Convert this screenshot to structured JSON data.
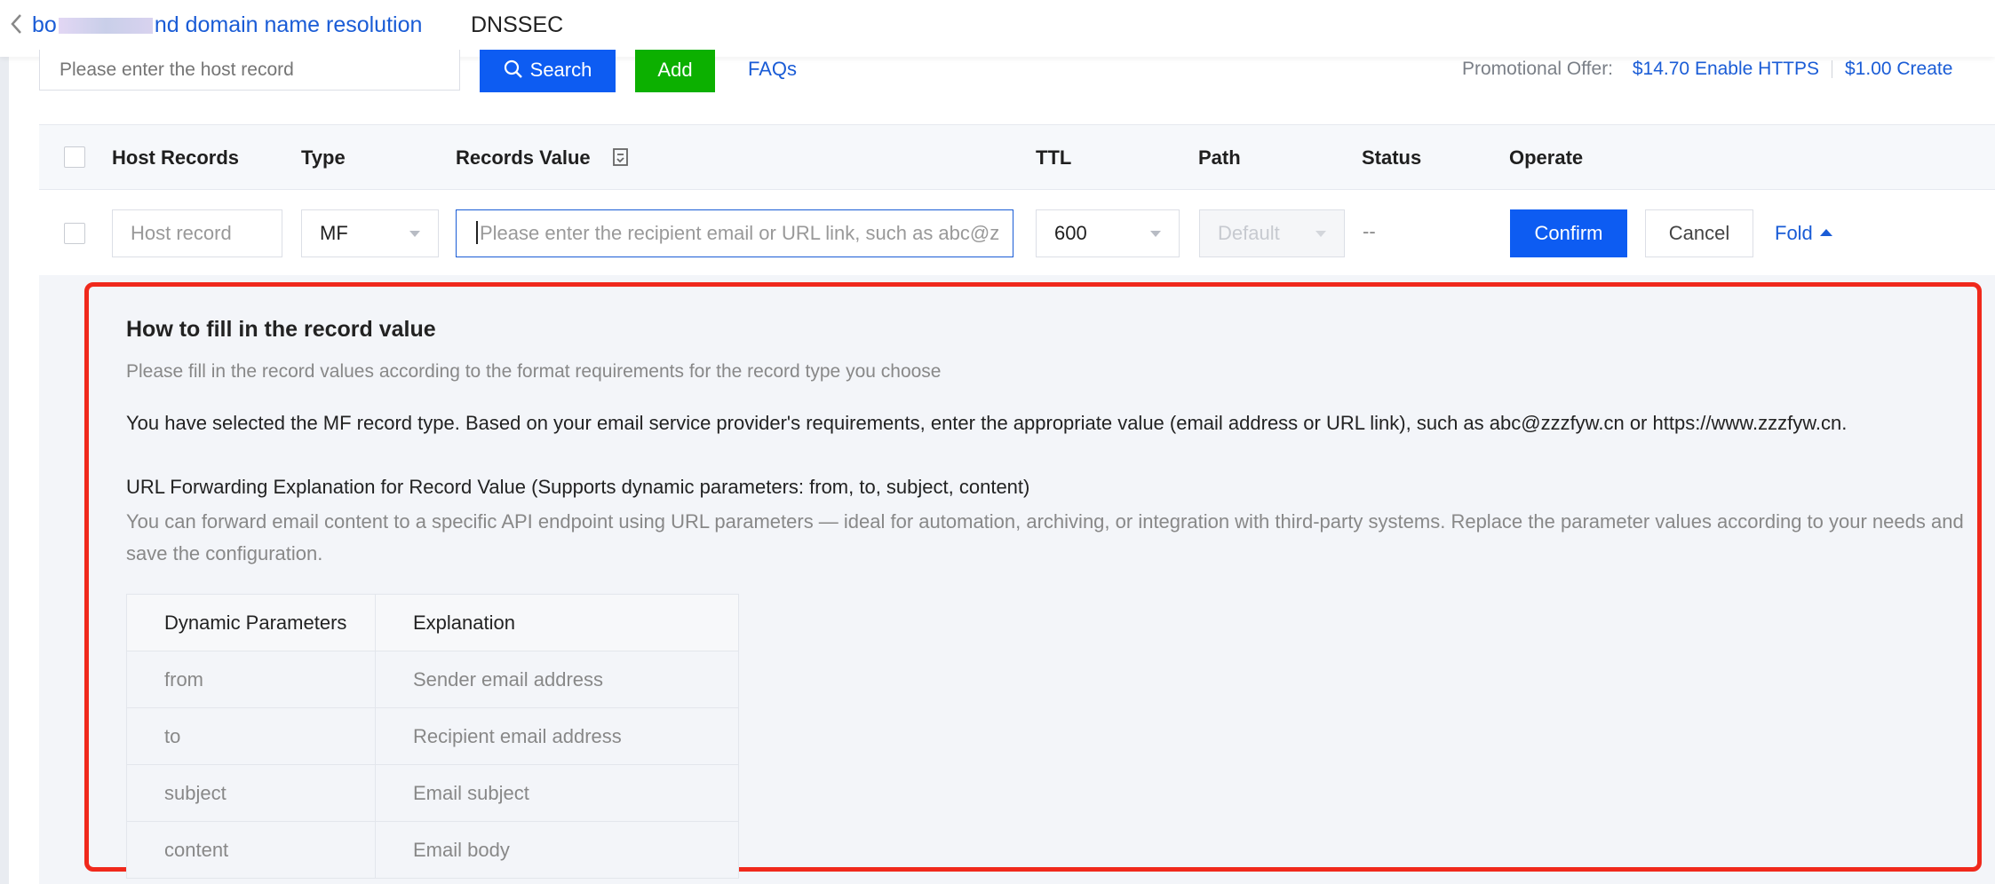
{
  "tabs": {
    "domain_tab_prefix": "bo",
    "domain_tab_suffix": "nd domain name resolution",
    "dnssec": "DNSSEC"
  },
  "toolbar": {
    "search_placeholder": "Please enter the host record",
    "search_label": "Search",
    "add_label": "Add",
    "faqs_label": "FAQs",
    "promo_label": "Promotional Offer:",
    "promo_https": "$14.70 Enable HTTPS",
    "promo_create": "$1.00 Create"
  },
  "table": {
    "headers": {
      "host": "Host Records",
      "type": "Type",
      "value": "Records Value",
      "ttl": "TTL",
      "path": "Path",
      "status": "Status",
      "operate": "Operate"
    },
    "edit_row": {
      "host_placeholder": "Host record",
      "type_value": "MF",
      "value_placeholder": "Please enter the recipient email or URL link, such as abc@z",
      "ttl_value": "600",
      "path_value": "Default",
      "status_value": "--",
      "confirm_label": "Confirm",
      "cancel_label": "Cancel",
      "fold_label": "Fold"
    }
  },
  "help": {
    "title": "How to fill in the record value",
    "subtitle": "Please fill in the record values according to the format requirements for the record type you choose",
    "selected_text": "You have selected the MF record type. Based on your email service provider's requirements, enter the appropriate value (email address or URL link), such as abc@zzzfyw.cn or https://www.zzzfyw.cn.",
    "url_heading": "URL Forwarding Explanation for Record Value (Supports dynamic parameters: from, to, subject, content)",
    "url_description": "You can forward email content to a specific API endpoint using URL parameters — ideal for automation, archiving, or integration with third-party systems. Replace the parameter values according to your needs and save the configuration.",
    "param_headers": {
      "param": "Dynamic Parameters",
      "explanation": "Explanation"
    },
    "params": [
      {
        "name": "from",
        "desc": "Sender email address"
      },
      {
        "name": "to",
        "desc": "Recipient email address"
      },
      {
        "name": "subject",
        "desc": "Email subject"
      },
      {
        "name": "content",
        "desc": "Email body"
      }
    ]
  },
  "colors": {
    "primary": "#0d5cf2",
    "link": "#1a5cd6",
    "add_green": "#0cb000",
    "highlight_red": "#f0291c"
  }
}
